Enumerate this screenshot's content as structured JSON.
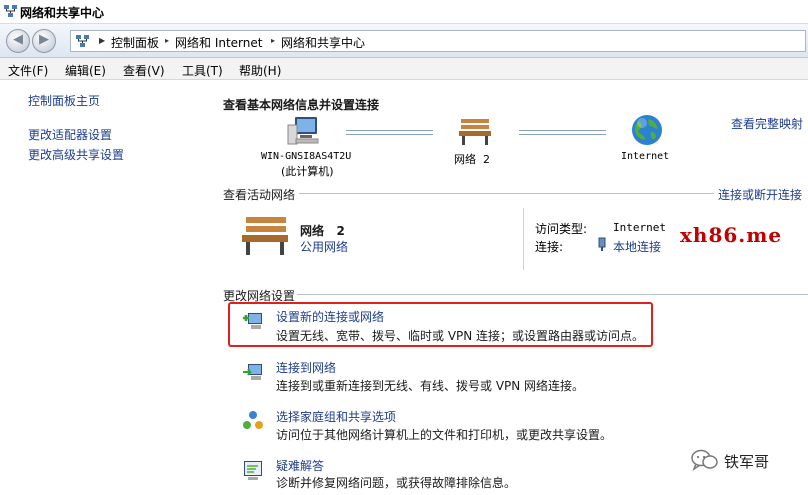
{
  "window": {
    "title": "网络和共享中心"
  },
  "address": {
    "crumbs": [
      "控制面板",
      "网络和 Internet",
      "网络和共享中心"
    ],
    "arrows": [
      "▶",
      "▸",
      "▸"
    ]
  },
  "menu": [
    "文件(F)",
    "编辑(E)",
    "查看(V)",
    "工具(T)",
    "帮助(H)"
  ],
  "sidebar": {
    "home": "控制面板主页",
    "adapter": "更改适配器设置",
    "advanced": "更改高级共享设置"
  },
  "main": {
    "basic_heading": "查看基本网络信息并设置连接",
    "full_map": "查看完整映射",
    "map": {
      "computer_name": "WIN-GNSI8AS4T2U",
      "computer_sub": "(此计算机)",
      "network_name": "网络  2",
      "internet": "Internet"
    },
    "active": {
      "title": "查看活动网络",
      "connect_link": "连接或断开连接",
      "network_name": "网络   2",
      "network_type": "公用网络",
      "access_label": "访问类型:",
      "access_value": "Internet",
      "conn_label": "连接:",
      "conn_value": "本地连接"
    },
    "change": {
      "title": "更改网络设置",
      "tasks": [
        {
          "title": "设置新的连接或网络",
          "desc": "设置无线、宽带、拨号、临时或 VPN 连接；或设置路由器或访问点。",
          "icon": "new-connection-icon"
        },
        {
          "title": "连接到网络",
          "desc": "连接到或重新连接到无线、有线、拨号或 VPN 网络连接。",
          "icon": "connect-network-icon"
        },
        {
          "title": "选择家庭组和共享选项",
          "desc": "访问位于其他网络计算机上的文件和打印机，或更改共享设置。",
          "icon": "homegroup-icon"
        },
        {
          "title": "疑难解答",
          "desc": "诊断并修复网络问题，或获得故障排除信息。",
          "icon": "troubleshoot-icon"
        }
      ]
    }
  },
  "watermark": "xh86.me",
  "wechat": {
    "name": "铁军哥"
  },
  "colors": {
    "link": "#1d3d8f",
    "highlight": "#e0201c",
    "watermark": "#c10000"
  }
}
